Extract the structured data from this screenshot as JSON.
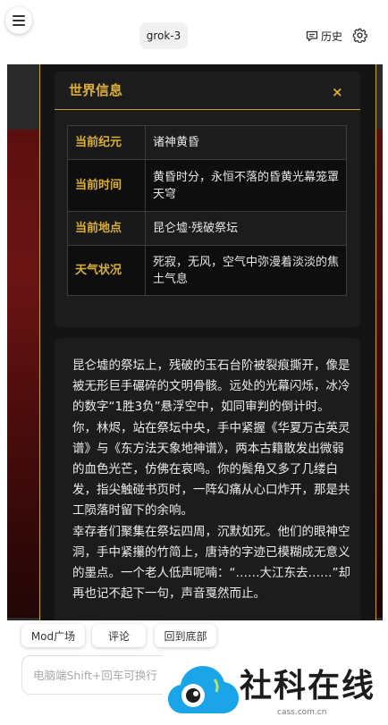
{
  "header": {
    "model": "grok-3",
    "history_label": "历史"
  },
  "world_info": {
    "title": "世界信息",
    "close_glyph": "×",
    "rows": [
      {
        "key": "当前纪元",
        "value": "诸神黄昏"
      },
      {
        "key": "当前时间",
        "value": "黄昏时分，永恒不落的昏黄光幕笼罩天穹"
      },
      {
        "key": "当前地点",
        "value": "昆仑墟·残破祭坛"
      },
      {
        "key": "天气状况",
        "value": "死寂，无风，空气中弥漫着淡淡的焦土气息"
      }
    ]
  },
  "story": {
    "text": "昆仑墟的祭坛上，残破的玉石台阶被裂痕撕开，像是被无形巨手碾碎的文明骨骸。远处的光幕闪烁，冰冷的数字“1胜3负”悬浮空中，如同审判的倒计时。你，林烬，站在祭坛中央，手中紧握《华夏万古英灵谱》与《东方法天象地神谱》，两本古籍散发出微弱的血色光芒，仿佛在哀鸣。你的鬓角又多了几缕白发，指尖触碰书页时，一阵幻痛从心口炸开，那是共工陨落时留下的余响。\n幸存者们聚集在祭坛四周，沉默如死。他们的眼神空洞，手中紧攥的竹简上，唐诗的字迹已模糊成无意义的墨点。一个老人低声呢喃：“……大江东去……”却再也记不起下一句，声音戛然而止。"
  },
  "quick_actions": [
    "Mod广场",
    "评论",
    "回到底部"
  ],
  "composer": {
    "placeholder": "电脑端Shift+回车可换行"
  },
  "watermark": {
    "name": "社科在线",
    "url": "cass.com.cn"
  },
  "colors": {
    "gold": "#d9ae3a",
    "panel_bg": "#141414",
    "card_bg": "#1c1c1c",
    "crimson": "#5c0f0f",
    "logo_blue": "#1aa5e8"
  }
}
